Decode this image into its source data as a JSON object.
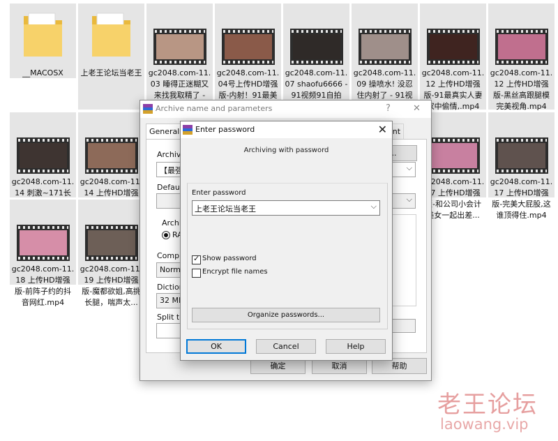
{
  "explorer": {
    "tiles": [
      {
        "kind": "folder",
        "caption": "__MACOSX"
      },
      {
        "kind": "folder",
        "caption": "上老王论坛当老王"
      },
      {
        "kind": "video",
        "caption": "gc2048.com-11.03 睡得正迷糊又来找我取精了 -",
        "art": "#b89684"
      },
      {
        "kind": "video",
        "caption": "gc2048.com-11.04号上传HD增强版-内射！91最美",
        "art": "#8a5a49"
      },
      {
        "kind": "video",
        "caption": "gc2048.com-11.07 shaofu6666 - 91视频91自拍",
        "art": "#2f2a28"
      },
      {
        "kind": "video",
        "caption": "gc2048.com-11.09 操喷水! 没忍住内射了 - 91视",
        "art": "#9f8f8a"
      },
      {
        "kind": "video",
        "caption": "gc2048.com-11.12 上传HD增强版-91最真实人妻家中偷情,.mp4",
        "art": "#3f2420"
      },
      {
        "kind": "video",
        "caption": "gc2048.com-11.12 上传HD增强版-黑丝高跟腿模完美视角.mp4",
        "art": "#c06f8e"
      },
      {
        "kind": "video",
        "caption": "gc2048.com-11.14 刺激~171长腿爆乳女神对窗干 - 91视频91...",
        "art": "#3e3431"
      },
      {
        "kind": "video",
        "caption": "gc2048.com-11.14 上传HD增强版-小区业主群认识的蜜桃臀少...",
        "art": "#8d6a59"
      },
      {
        "kind": "video",
        "caption": "gc2048.com-11.17 上传HD增强版-和公司小会计美女一起出差...",
        "art": "#c880a0"
      },
      {
        "kind": "video",
        "caption": "gc2048.com-11.17 上传HD增强版-完美大屁股,这谁顶得住.mp4",
        "art": "#5f524e"
      },
      {
        "kind": "video",
        "caption": "gc2048.com-11.18 上传HD增强版-前阵子约的抖音网红.mp4",
        "art": "#d68ea8"
      },
      {
        "kind": "video",
        "caption": "gc2048.com-11.19 上传HD增强版-魔都欲姐,高挑长腿，喘声太...",
        "art": "#6d5f57"
      }
    ]
  },
  "archive_dialog": {
    "title": "Archive name and parameters",
    "help": "?",
    "close": "✕",
    "tab_general": "General",
    "tab_right": "ent",
    "archive_label": "Archive",
    "archive_value": "【最强",
    "browse": "se...",
    "default_label": "Default",
    "archive_format_label": "Archiv",
    "radio_label": "RA",
    "compression_label": "Compre",
    "compression_value": "Norma",
    "dictionary_label": "Dictiona",
    "dictionary_value": "32 MB",
    "split_label": "Split to",
    "ok": "确定",
    "cancel": "取消",
    "help_btn": "帮助"
  },
  "password_dialog": {
    "title": "Enter password",
    "close": "✕",
    "caption": "Archiving with password",
    "field_label": "Enter password",
    "password_value": "上老王论坛当老王",
    "show_password": "Show password",
    "show_password_checked": true,
    "encrypt_names": "Encrypt file names",
    "encrypt_names_checked": false,
    "organize": "Organize passwords...",
    "ok": "OK",
    "cancel": "Cancel",
    "help": "Help"
  },
  "watermark": {
    "line1": "老王论坛",
    "line2": "laowang.vip"
  }
}
